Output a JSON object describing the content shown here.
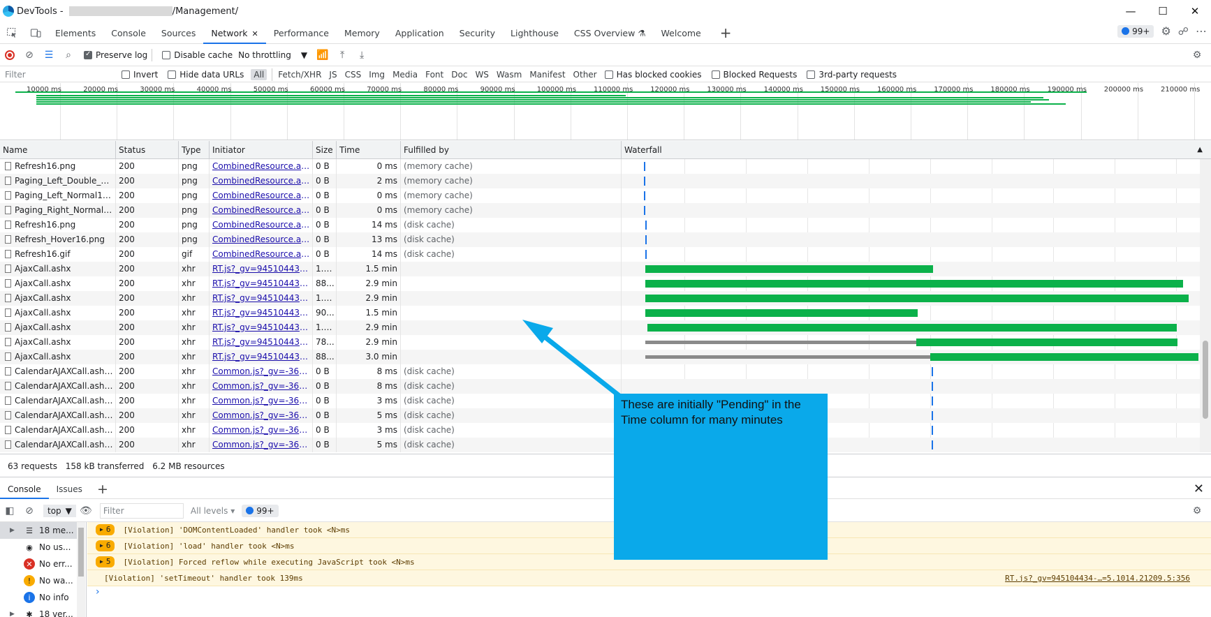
{
  "window": {
    "title_prefix": "DevTools - ",
    "title_suffix": "/Management/"
  },
  "tabs": [
    {
      "label": "Elements"
    },
    {
      "label": "Console"
    },
    {
      "label": "Sources"
    },
    {
      "label": "Network",
      "active": true
    },
    {
      "label": "Performance"
    },
    {
      "label": "Memory"
    },
    {
      "label": "Application"
    },
    {
      "label": "Security"
    },
    {
      "label": "Lighthouse"
    },
    {
      "label": "CSS Overview"
    },
    {
      "label": "Welcome"
    }
  ],
  "issues_badge": "99+",
  "toolbar": {
    "preserve_log": "Preserve log",
    "disable_cache": "Disable cache",
    "throttling": "No throttling"
  },
  "filterbar": {
    "placeholder": "Filter",
    "invert": "Invert",
    "hide_data_urls": "Hide data URLs",
    "types": [
      "All",
      "Fetch/XHR",
      "JS",
      "CSS",
      "Img",
      "Media",
      "Font",
      "Doc",
      "WS",
      "Wasm",
      "Manifest",
      "Other"
    ],
    "has_blocked_cookies": "Has blocked cookies",
    "blocked_requests": "Blocked Requests",
    "third_party": "3rd-party requests"
  },
  "overview_ticks": [
    "10000 ms",
    "20000 ms",
    "30000 ms",
    "40000 ms",
    "50000 ms",
    "60000 ms",
    "70000 ms",
    "80000 ms",
    "90000 ms",
    "100000 ms",
    "110000 ms",
    "120000 ms",
    "130000 ms",
    "140000 ms",
    "150000 ms",
    "160000 ms",
    "170000 ms",
    "180000 ms",
    "190000 ms",
    "200000 ms",
    "210000 ms"
  ],
  "columns": {
    "name": "Name",
    "status": "Status",
    "type": "Type",
    "initiator": "Initiator",
    "size": "Size",
    "time": "Time",
    "fulfilled": "Fulfilled by",
    "waterfall": "Waterfall"
  },
  "rows": [
    {
      "name": "Refresh16.png",
      "status": "200",
      "type": "png",
      "initiator": "CombinedResource.ashx...",
      "size": "0 B",
      "time": "0 ms",
      "fulfilled": "(memory cache)"
    },
    {
      "name": "Paging_Left_Double_No...",
      "status": "200",
      "type": "png",
      "initiator": "CombinedResource.ashx...",
      "size": "0 B",
      "time": "2 ms",
      "fulfilled": "(memory cache)"
    },
    {
      "name": "Paging_Left_Normal16.p...",
      "status": "200",
      "type": "png",
      "initiator": "CombinedResource.ashx...",
      "size": "0 B",
      "time": "0 ms",
      "fulfilled": "(memory cache)"
    },
    {
      "name": "Paging_Right_Normal16...",
      "status": "200",
      "type": "png",
      "initiator": "CombinedResource.ashx...",
      "size": "0 B",
      "time": "0 ms",
      "fulfilled": "(memory cache)"
    },
    {
      "name": "Refresh16.png",
      "status": "200",
      "type": "png",
      "initiator": "CombinedResource.ashx...",
      "size": "0 B",
      "time": "14 ms",
      "fulfilled": "(disk cache)"
    },
    {
      "name": "Refresh_Hover16.png",
      "status": "200",
      "type": "png",
      "initiator": "CombinedResource.ashx...",
      "size": "0 B",
      "time": "13 ms",
      "fulfilled": "(disk cache)"
    },
    {
      "name": "Refresh16.gif",
      "status": "200",
      "type": "gif",
      "initiator": "CombinedResource.ashx...",
      "size": "0 B",
      "time": "14 ms",
      "fulfilled": "(disk cache)"
    },
    {
      "name": "AjaxCall.ashx",
      "status": "200",
      "type": "xhr",
      "initiator": "RT.js?_gv=945104434-2...",
      "size": "1.1...",
      "time": "1.5 min",
      "fulfilled": ""
    },
    {
      "name": "AjaxCall.ashx",
      "status": "200",
      "type": "xhr",
      "initiator": "RT.js?_gv=945104434-2...",
      "size": "88...",
      "time": "2.9 min",
      "fulfilled": ""
    },
    {
      "name": "AjaxCall.ashx",
      "status": "200",
      "type": "xhr",
      "initiator": "RT.js?_gv=945104434-2...",
      "size": "1.4...",
      "time": "2.9 min",
      "fulfilled": ""
    },
    {
      "name": "AjaxCall.ashx",
      "status": "200",
      "type": "xhr",
      "initiator": "RT.js?_gv=945104434-2...",
      "size": "90...",
      "time": "1.5 min",
      "fulfilled": ""
    },
    {
      "name": "AjaxCall.ashx",
      "status": "200",
      "type": "xhr",
      "initiator": "RT.js?_gv=945104434-2...",
      "size": "1.1...",
      "time": "2.9 min",
      "fulfilled": ""
    },
    {
      "name": "AjaxCall.ashx",
      "status": "200",
      "type": "xhr",
      "initiator": "RT.js?_gv=945104434-2...",
      "size": "78...",
      "time": "2.9 min",
      "fulfilled": ""
    },
    {
      "name": "AjaxCall.ashx",
      "status": "200",
      "type": "xhr",
      "initiator": "RT.js?_gv=945104434-2...",
      "size": "88...",
      "time": "3.0 min",
      "fulfilled": ""
    },
    {
      "name": "CalendarAJAXCall.ashx?...",
      "status": "200",
      "type": "xhr",
      "initiator": "Common.js?_gv=-36634...",
      "size": "0 B",
      "time": "8 ms",
      "fulfilled": "(disk cache)"
    },
    {
      "name": "CalendarAJAXCall.ashx?...",
      "status": "200",
      "type": "xhr",
      "initiator": "Common.js?_gv=-36634...",
      "size": "0 B",
      "time": "8 ms",
      "fulfilled": "(disk cache)"
    },
    {
      "name": "CalendarAJAXCall.ashx?...",
      "status": "200",
      "type": "xhr",
      "initiator": "Common.js?_gv=-36634...",
      "size": "0 B",
      "time": "3 ms",
      "fulfilled": "(disk cache)"
    },
    {
      "name": "CalendarAJAXCall.ashx?...",
      "status": "200",
      "type": "xhr",
      "initiator": "Common.js?_gv=-36634...",
      "size": "0 B",
      "time": "5 ms",
      "fulfilled": "(disk cache)"
    },
    {
      "name": "CalendarAJAXCall.ashx?...",
      "status": "200",
      "type": "xhr",
      "initiator": "Common.js?_gv=-36634...",
      "size": "0 B",
      "time": "3 ms",
      "fulfilled": "(disk cache)"
    },
    {
      "name": "CalendarAJAXCall.ashx?...",
      "status": "200",
      "type": "xhr",
      "initiator": "Common.js?_gv=-36634...",
      "size": "0 B",
      "time": "5 ms",
      "fulfilled": "(disk cache)"
    }
  ],
  "status": {
    "requests": "63 requests",
    "transferred": "158 kB transferred",
    "resources": "6.2 MB resources"
  },
  "drawer": {
    "tabs": [
      "Console",
      "Issues"
    ],
    "context": "top",
    "filter_placeholder": "Filter",
    "levels": "All levels",
    "issues_badge": "99+",
    "sidebar": [
      {
        "label": "18 me...",
        "icon": "list-icon"
      },
      {
        "label": "No us...",
        "icon": "user-icon"
      },
      {
        "label": "No err...",
        "icon": "error-icon"
      },
      {
        "label": "No wa...",
        "icon": "warning-icon"
      },
      {
        "label": "No info",
        "icon": "info-icon"
      },
      {
        "label": "18 ver...",
        "icon": "bug-icon"
      }
    ],
    "messages": [
      {
        "count": "6",
        "text": "[Violation] 'DOMContentLoaded' handler took <N>ms",
        "source": ""
      },
      {
        "count": "6",
        "text": "[Violation] 'load' handler took <N>ms",
        "source": ""
      },
      {
        "count": "5",
        "text": "[Violation] Forced reflow while executing JavaScript took <N>ms",
        "source": ""
      },
      {
        "count": "",
        "text": "[Violation] 'setTimeout' handler took 139ms",
        "source": "RT.js?_gv=945104434-…=5.1014.21209.5:356"
      }
    ]
  },
  "callout": {
    "text": "These are initially \"Pending\" in the Time column for many minutes"
  }
}
